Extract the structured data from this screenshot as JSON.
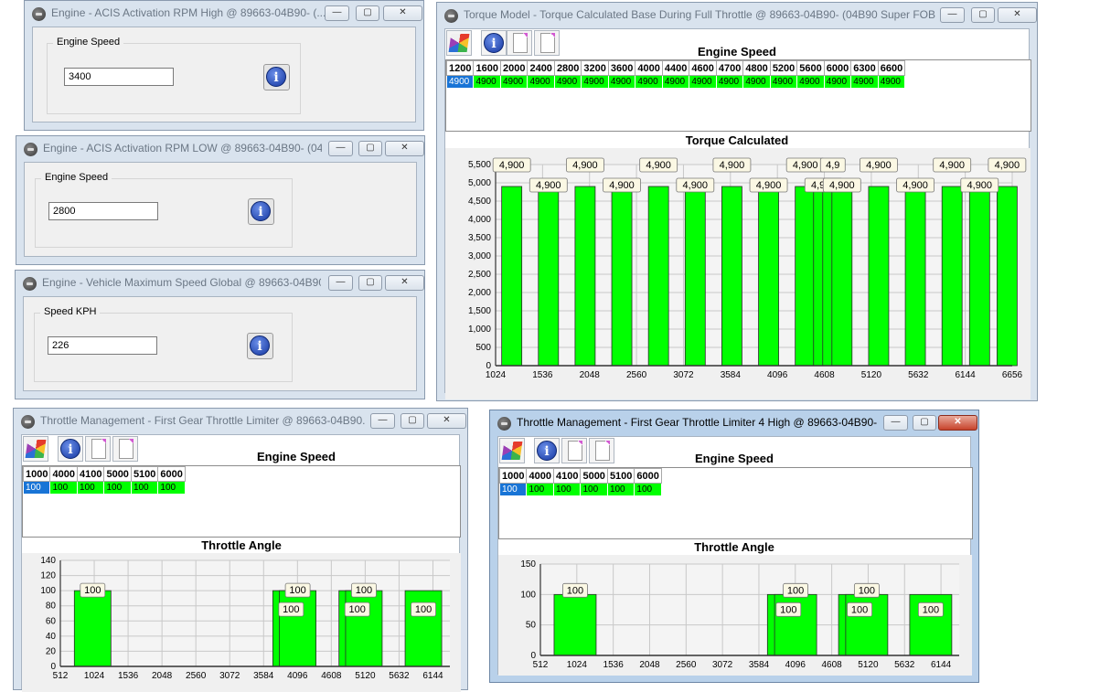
{
  "colors": {
    "bar": "#00ff00",
    "bar_edge": "#2b2b2b",
    "selected_cell": "#1874d6",
    "grid": "#c8c8c8"
  },
  "windows": {
    "acis_high": {
      "title": "Engine - ACIS Activation RPM High @ 89663-04B90- (...",
      "group_label": "Engine Speed",
      "value": "3400",
      "info_icon": "info-icon"
    },
    "acis_low": {
      "title": "Engine - ACIS Activation RPM LOW @ 89663-04B90- (04...",
      "group_label": "Engine Speed",
      "value": "2800",
      "info_icon": "info-icon"
    },
    "vmax": {
      "title": "Engine - Vehicle Maximum Speed Global @ 89663-04B90...",
      "group_label": "Speed KPH",
      "value": "226",
      "info_icon": "info-icon"
    },
    "torque": {
      "title": "Torque Model - Torque Calculated Base During Full Throttle @ 89663-04B90- (04B90 Super FOB P...",
      "header": "Engine Speed",
      "chart_title": "Torque Calculated",
      "columns": [
        "1200",
        "1600",
        "2000",
        "2400",
        "2800",
        "3200",
        "3600",
        "4000",
        "4400",
        "4600",
        "4700",
        "4800",
        "5200",
        "5600",
        "6000",
        "6300",
        "6600"
      ],
      "row": [
        "4900",
        "4900",
        "4900",
        "4900",
        "4900",
        "4900",
        "4900",
        "4900",
        "4900",
        "4900",
        "4900",
        "4900",
        "4900",
        "4900",
        "4900",
        "4900",
        "4900"
      ]
    },
    "fgtl": {
      "title": "Throttle Management - First Gear Throttle Limiter @ 89663-04B90...",
      "header": "Engine Speed",
      "chart_title": "Throttle Angle",
      "columns": [
        "1000",
        "4000",
        "4100",
        "5000",
        "5100",
        "6000"
      ],
      "row": [
        "100",
        "100",
        "100",
        "100",
        "100",
        "100"
      ]
    },
    "fgtl4": {
      "title": "Throttle Management - First Gear Throttle Limiter 4 High @ 89663-04B90-...",
      "header": "Engine Speed",
      "chart_title": "Throttle Angle",
      "columns": [
        "1000",
        "4000",
        "4100",
        "5000",
        "5100",
        "6000"
      ],
      "row": [
        "100",
        "100",
        "100",
        "100",
        "100",
        "100"
      ]
    }
  },
  "window_controls": {
    "minimize": "—",
    "maximize": "▢",
    "close": "✕"
  },
  "chart_data": [
    {
      "type": "bar",
      "title": "Torque Calculated",
      "xlabel": "",
      "ylabel": "",
      "x": [
        1200,
        1600,
        2000,
        2400,
        2800,
        3200,
        3600,
        4000,
        4400,
        4600,
        4700,
        4800,
        5200,
        5600,
        6000,
        6300,
        6600
      ],
      "values": [
        4900,
        4900,
        4900,
        4900,
        4900,
        4900,
        4900,
        4900,
        4900,
        4900,
        4900,
        4900,
        4900,
        4900,
        4900,
        4900,
        4900
      ],
      "data_labels": [
        "4,900",
        "4,900",
        "4,900",
        "4,900",
        "4,900",
        "4,900",
        "4,900",
        "4,900",
        "4,900",
        "4,900",
        "4,9",
        "4,900",
        "4,900",
        "4,900",
        "4,900",
        "4,900",
        "4,900"
      ],
      "xlim": [
        1024,
        6656
      ],
      "ylim": [
        0,
        5500
      ],
      "xticks": [
        "1024",
        "1536",
        "2048",
        "2560",
        "3072",
        "3584",
        "4096",
        "4608",
        "5120",
        "5632",
        "6144",
        "6656"
      ],
      "yticks": [
        "0",
        "500",
        "1,000",
        "1,500",
        "2,000",
        "2,500",
        "3,000",
        "3,500",
        "4,000",
        "4,500",
        "5,000",
        "5,500"
      ],
      "grid": true
    },
    {
      "type": "bar",
      "title": "Throttle Angle",
      "xlabel": "",
      "ylabel": "",
      "x": [
        1000,
        4000,
        4100,
        5000,
        5100,
        6000
      ],
      "values": [
        100,
        100,
        100,
        100,
        100,
        100
      ],
      "data_labels": [
        "100",
        "100",
        "100",
        "100",
        "100",
        "100"
      ],
      "xlim": [
        512,
        6400
      ],
      "ylim": [
        0,
        140
      ],
      "xticks": [
        "512",
        "1024",
        "1536",
        "2048",
        "2560",
        "3072",
        "3584",
        "4096",
        "4608",
        "5120",
        "5632",
        "6144"
      ],
      "yticks": [
        "0",
        "20",
        "40",
        "60",
        "80",
        "100",
        "120",
        "140"
      ],
      "grid": true
    },
    {
      "type": "bar",
      "title": "Throttle Angle",
      "xlabel": "",
      "ylabel": "",
      "x": [
        1000,
        4000,
        4100,
        5000,
        5100,
        6000
      ],
      "values": [
        100,
        100,
        100,
        100,
        100,
        100
      ],
      "data_labels": [
        "100",
        "100",
        "100",
        "100",
        "100",
        "100"
      ],
      "xlim": [
        512,
        6400
      ],
      "ylim": [
        0,
        150
      ],
      "xticks": [
        "512",
        "1024",
        "1536",
        "2048",
        "2560",
        "3072",
        "3584",
        "4096",
        "4608",
        "5120",
        "5632",
        "6144"
      ],
      "yticks": [
        "0",
        "50",
        "100",
        "150"
      ],
      "grid": true
    }
  ]
}
